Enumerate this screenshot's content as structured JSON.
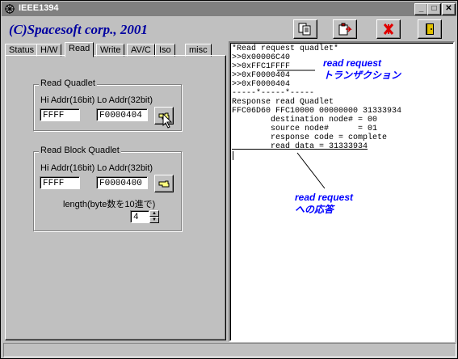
{
  "window": {
    "title": "IEEE1394",
    "minimize": "_",
    "maximize": "□",
    "close": "✕"
  },
  "header": {
    "company": "(C)Spacesoft corp., 2001"
  },
  "toolbar": {
    "icons": [
      "copy-icon",
      "paste-icon",
      "clear-icon",
      "exit-icon"
    ]
  },
  "tabs": [
    "Status",
    "H/W",
    "Read",
    "Write",
    "AV/C",
    "Iso",
    "misc"
  ],
  "active_tab": "Read",
  "read_quadlet": {
    "title": "Read Quadlet",
    "hi_label": "Hi Addr(16bit)",
    "lo_label": "Lo Addr(32bit)",
    "hi_value": "FFFF",
    "lo_value": "F0000404"
  },
  "read_block": {
    "title": "Read Block Quadlet",
    "hi_label": "Hi Addr(16bit)",
    "lo_label": "Lo Addr(32bit)",
    "hi_value": "FFFF",
    "lo_value": "F0000400",
    "length_label": "length(byte数を10進で)",
    "length_value": "4"
  },
  "output": {
    "lines": [
      "*Read request quadlet*",
      ">>0x00006C40",
      ">>0xFFC1FFFF",
      ">>0xF0000404",
      ">>0xF0000404",
      "-----*-----*-----",
      "Response read Quadlet",
      "FFC06D60 FFC10000 00000000 31333934",
      "        destination node# = 00",
      "        source node#      = 01",
      "        response code = complete",
      "        read data = 31333934"
    ]
  },
  "annotations": {
    "request_line1": "read request",
    "request_line2": "トランザクション",
    "response_line1": "read request",
    "response_line2": "への応答"
  }
}
